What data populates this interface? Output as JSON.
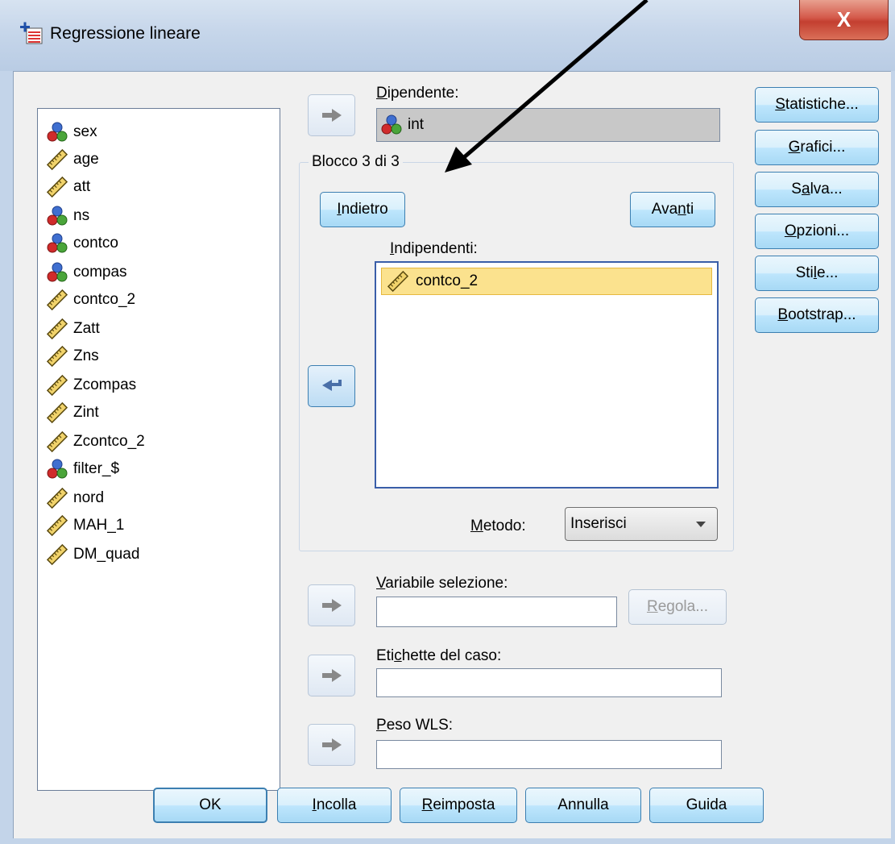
{
  "window": {
    "title": "Regressione lineare",
    "close_symbol": "X"
  },
  "variables": [
    {
      "name": "sex",
      "icon": "nominal-icon"
    },
    {
      "name": "age",
      "icon": "scale-icon"
    },
    {
      "name": "att",
      "icon": "scale-icon"
    },
    {
      "name": "ns",
      "icon": "nominal-icon"
    },
    {
      "name": "contco",
      "icon": "nominal-icon"
    },
    {
      "name": "compas",
      "icon": "nominal-icon"
    },
    {
      "name": "contco_2",
      "icon": "scale-icon"
    },
    {
      "name": "Zatt",
      "icon": "scale-icon"
    },
    {
      "name": "Zns",
      "icon": "scale-icon"
    },
    {
      "name": "Zcompas",
      "icon": "scale-icon"
    },
    {
      "name": "Zint",
      "icon": "scale-icon"
    },
    {
      "name": "Zcontco_2",
      "icon": "scale-icon"
    },
    {
      "name": "filter_$",
      "icon": "nominal-icon"
    },
    {
      "name": "nord",
      "icon": "scale-icon"
    },
    {
      "name": "MAH_1",
      "icon": "scale-icon"
    },
    {
      "name": "DM_quad",
      "icon": "scale-icon"
    }
  ],
  "dependent": {
    "label_u": "D",
    "label_rest": "ipendente:",
    "value": "int"
  },
  "block": {
    "title": "Blocco 3 di 3",
    "prev_u": "I",
    "prev_rest": "ndietro",
    "next_pre": "Ava",
    "next_u": "n",
    "next_post": "ti"
  },
  "independents": {
    "label_u": "I",
    "label_rest": "ndipendenti:",
    "items": [
      "contco_2"
    ]
  },
  "method": {
    "label_u": "M",
    "label_rest": "etodo:",
    "value": "Inserisci"
  },
  "selection_variable": {
    "label_u": "V",
    "label_rest": "ariabile selezione:",
    "value": "",
    "rule_button_u": "R",
    "rule_button_rest": "egola..."
  },
  "case_labels": {
    "label_pre": "Eti",
    "label_u": "c",
    "label_post": "hette del caso:",
    "value": ""
  },
  "wls_weight": {
    "label_u": "P",
    "label_rest": "eso WLS:",
    "value": ""
  },
  "side_buttons": [
    {
      "pre": "",
      "u": "S",
      "post": "tatistiche..."
    },
    {
      "pre": "",
      "u": "G",
      "post": "rafici..."
    },
    {
      "pre": "S",
      "u": "a",
      "post": "lva..."
    },
    {
      "pre": "",
      "u": "O",
      "post": "pzioni..."
    },
    {
      "pre": "Sti",
      "u": "l",
      "post": "e..."
    },
    {
      "pre": "",
      "u": "B",
      "post": "ootstrap..."
    }
  ],
  "bottom_buttons": [
    {
      "pre": "OK",
      "u": "",
      "post": ""
    },
    {
      "pre": "",
      "u": "I",
      "post": "ncolla"
    },
    {
      "pre": "",
      "u": "R",
      "post": "eimposta"
    },
    {
      "pre": "Annulla",
      "u": "",
      "post": ""
    },
    {
      "pre": "Guida",
      "u": "",
      "post": ""
    }
  ],
  "colors": {
    "button_border": "#3c7fb1",
    "selection_highlight": "#fbe28e",
    "list_border": "#3a5ea8",
    "close_button": "#c33f30"
  }
}
